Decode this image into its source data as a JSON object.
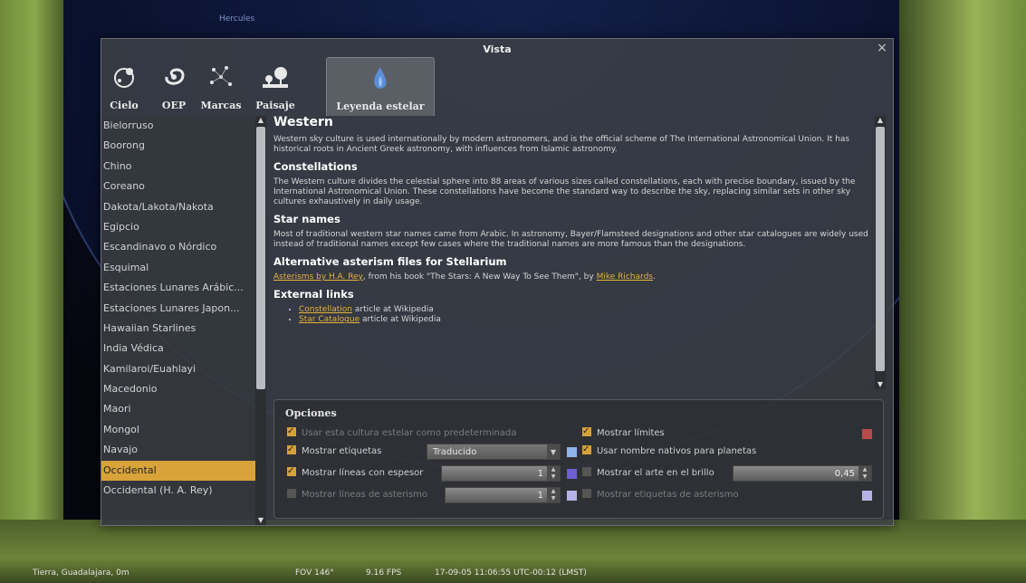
{
  "window": {
    "title": "Vista",
    "close_label": "×"
  },
  "tabs": [
    {
      "label": "Cielo",
      "icon": "sky-icon"
    },
    {
      "label": "OEP",
      "icon": "galaxy-icon"
    },
    {
      "label": "Marcas",
      "icon": "markings-icon"
    },
    {
      "label": "Paisaje",
      "icon": "landscape-icon"
    },
    {
      "label": "Leyenda estelar",
      "icon": "starlore-icon"
    }
  ],
  "sky_labels": [
    "Hercules"
  ],
  "cultures": [
    "Bielorruso",
    "Boorong",
    "Chino",
    "Coreano",
    "Dakota/Lakota/Nakota",
    "Egipcio",
    "Escandinavo o Nórdico",
    "Esquimal",
    "Estaciones Lunares Arábic...",
    "Estaciones Lunares Japon...",
    "Hawaiian Starlines",
    "India Védica",
    "Kamilaroi/Euahlayi",
    "Macedonio",
    "Maori",
    "Mongol",
    "Navajo",
    "Occidental",
    "Occidental (H. A. Rey)"
  ],
  "selected_culture": "Occidental",
  "article": {
    "title": "Western",
    "intro": "Western sky culture is used internationally by modern astronomers, and is the official scheme of The International Astronomical Union. It has historical roots in Ancient Greek astronomy, with influences from Islamic astronomy.",
    "h_constellations": "Constellations",
    "constellations_text": "The Western culture divides the celestial sphere into 88 areas of various sizes called constellations, each with precise boundary, issued by the International Astronomical Union. These constellations have become the standard way to describe the sky, replacing similar sets in other sky cultures exhaustively in daily usage.",
    "h_star_names": "Star names",
    "star_names_text": "Most of traditional western star names came from Arabic. In astronomy, Bayer/Flamsteed designations and other star catalogues are widely used instead of traditional names except few cases where the traditional names are more famous than the designations.",
    "h_alt": "Alternative asterism files for Stellarium",
    "alt_link1": "Asterisms by H.A. Rey",
    "alt_mid": ", from his book \"The Stars: A New Way To See Them\", by ",
    "alt_link2": "Mike Richards",
    "alt_end": ".",
    "h_links": "External links",
    "link1": "Constellation",
    "link1_tail": " article at Wikipedia",
    "link2": "Star Catalogue",
    "link2_tail": " article at Wikipedia"
  },
  "options": {
    "title": "Opciones",
    "use_default": "Usar esta cultura estelar como predeterminada",
    "show_labels": "Mostrar etiquetas",
    "labels_select": "Traducido",
    "thick_lines": "Mostrar líneas con espesor",
    "thick_value": "1",
    "asterism_lines": "Mostrar líneas de asterismo",
    "asterism_value": "1",
    "show_limits": "Mostrar límites",
    "native_planet_names": "Usar nombre nativos para planetas",
    "art_brightness": "Mostrar el arte en el brillo",
    "art_value": "0,45",
    "asterism_labels": "Mostrar etiquetas de asterismo"
  },
  "status": {
    "location": "Tierra, Guadalajara, 0m",
    "fov": "FOV 146°",
    "fps": "9.16 FPS",
    "datetime": "17-09-05 11:06:55 UTC-00:12 (LMST)"
  },
  "colors": {
    "accent": "#d9a33a",
    "swatch_limits": "#b84a4a",
    "swatch_labels": "#8fb4e8",
    "swatch_lines": "#6c5fd0",
    "swatch_asterism_lines": "#b7b2e6",
    "swatch_asterism_labels": "#b7b2e6"
  }
}
